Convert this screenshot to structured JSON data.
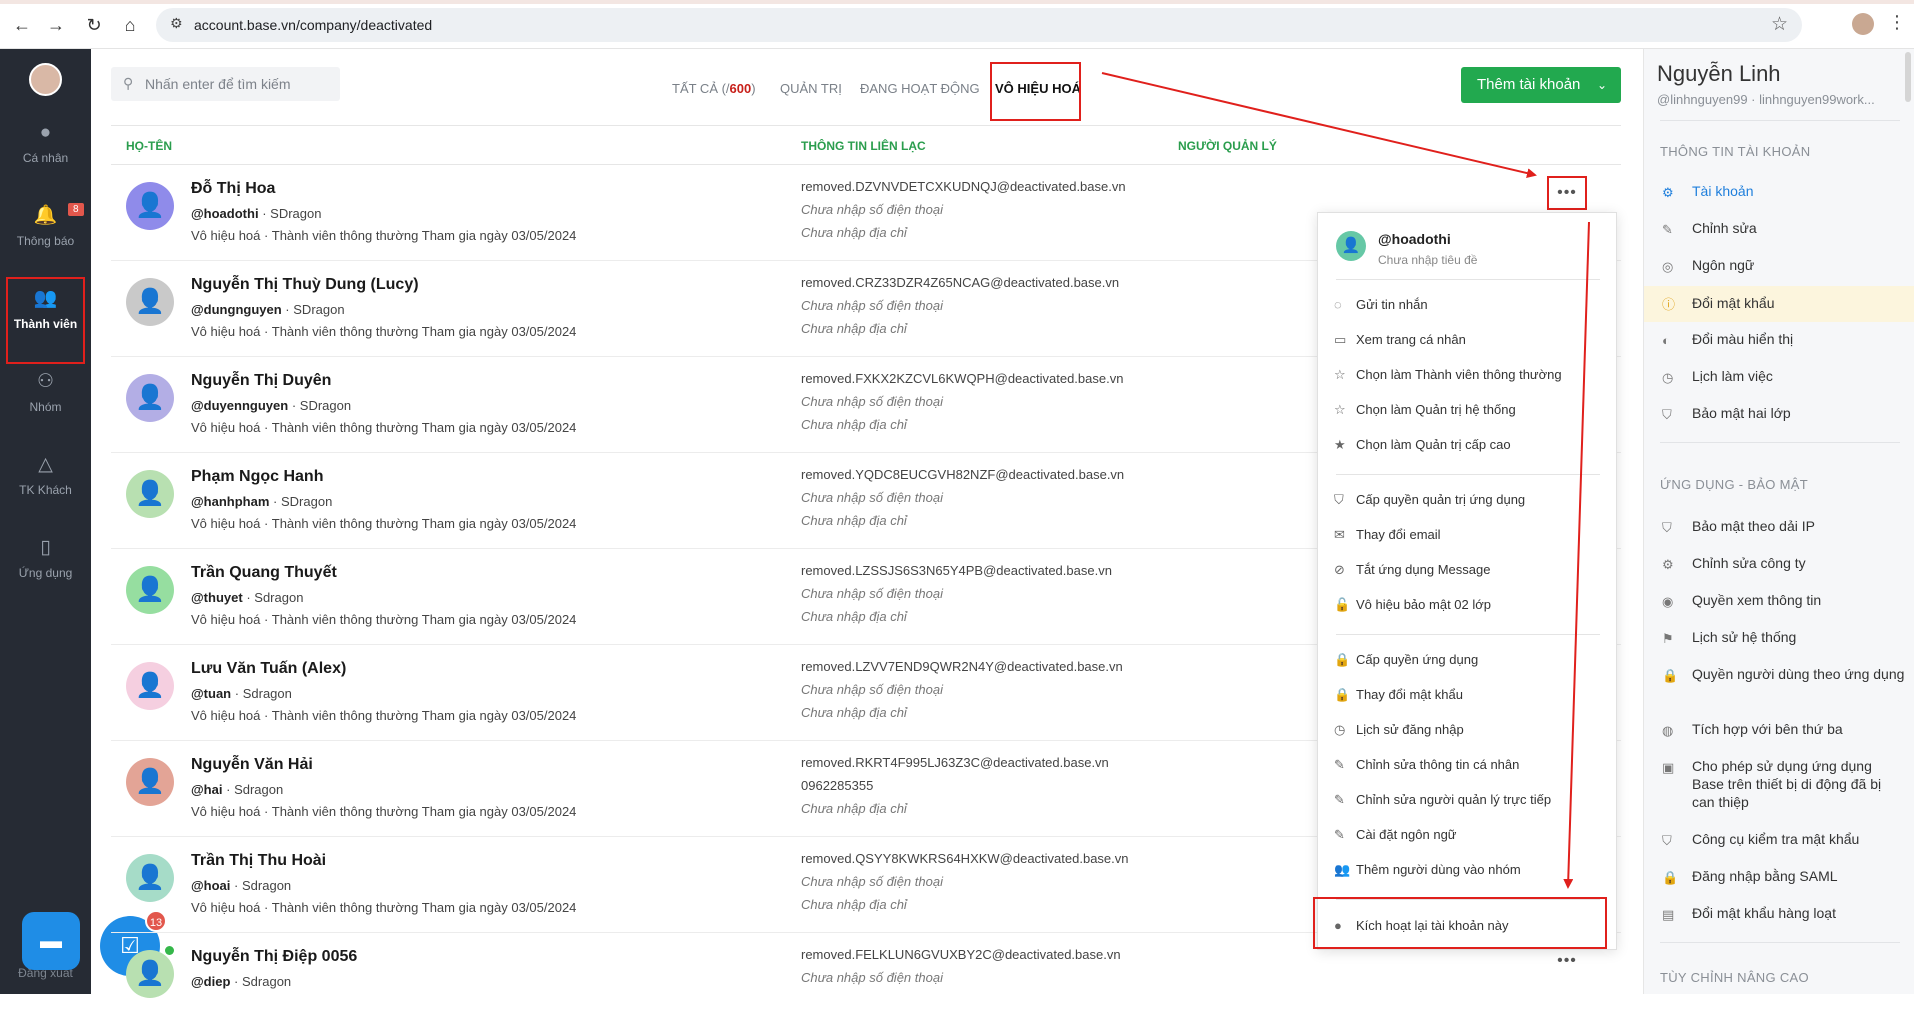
{
  "browser": {
    "url": "account.base.vn/company/deactivated",
    "back_icon": "←",
    "forward_icon": "→",
    "reload_icon": "↻",
    "home_icon": "⌂",
    "star_icon": "☆",
    "tune_icon": "⚙",
    "menu_icon": "⋮"
  },
  "sidebar": {
    "items": [
      {
        "label": "Cá nhân",
        "icon": "●"
      },
      {
        "label": "Thông báo",
        "icon": "🔔",
        "badge": "8"
      },
      {
        "label": "Thành viên",
        "icon": "👥"
      },
      {
        "label": "Nhóm",
        "icon": "⚇"
      },
      {
        "label": "TK Khách",
        "icon": "△"
      },
      {
        "label": "Ứng dụng",
        "icon": "▯"
      }
    ],
    "logout": "Đăng xuất",
    "chat_icon": "▬",
    "task_icon": "☑",
    "task_badge": "13"
  },
  "toolbar": {
    "search_placeholder": "Nhấn enter để tìm kiếm",
    "search_icon": "⚲",
    "tabs": {
      "all_prefix": "TẤT CẢ (/",
      "all_count": "600",
      "all_suffix": ")",
      "admin": "QUẢN TRỊ",
      "active": "ĐANG HOẠT ĐỘNG",
      "deactivated": "VÔ HIỆU HOÁ"
    },
    "add_button": "Thêm tài khoản",
    "add_chevron": "⌄"
  },
  "table": {
    "headers": {
      "name": "HỌ-TÊN",
      "contact": "THÔNG TIN LIÊN LẠC",
      "manager": "NGƯỜI QUẢN LÝ"
    },
    "rows": [
      {
        "name": "Đỗ Thị Hoa",
        "handle": "@hoadothi",
        "team": "SDragon",
        "status": "Vô hiệu hoá",
        "role": "Thành viên thông thường Tham gia ngày 03/05/2024",
        "email": "removed.DZVNVDETCXKUDNQJ@deactivated.base.vn",
        "phone": "Chưa nhập số điện thoại",
        "address": "Chưa nhập địa chỉ"
      },
      {
        "name": "Nguyễn Thị Thuỳ Dung (Lucy)",
        "handle": "@dungnguyen",
        "team": "SDragon",
        "status": "Vô hiệu hoá",
        "role": "Thành viên thông thường Tham gia ngày 03/05/2024",
        "email": "removed.CRZ33DZR4Z65NCAG@deactivated.base.vn",
        "phone": "Chưa nhập số điện thoại",
        "address": "Chưa nhập địa chỉ"
      },
      {
        "name": "Nguyễn Thị Duyên",
        "handle": "@duyennguyen",
        "team": "SDragon",
        "status": "Vô hiệu hoá",
        "role": "Thành viên thông thường Tham gia ngày 03/05/2024",
        "email": "removed.FXKX2KZCVL6KWQPH@deactivated.base.vn",
        "phone": "Chưa nhập số điện thoại",
        "address": "Chưa nhập địa chỉ"
      },
      {
        "name": "Phạm Ngọc Hanh",
        "handle": "@hanhpham",
        "team": "SDragon",
        "status": "Vô hiệu hoá",
        "role": "Thành viên thông thường Tham gia ngày 03/05/2024",
        "email": "removed.YQDC8EUCGVH82NZF@deactivated.base.vn",
        "phone": "Chưa nhập số điện thoại",
        "address": "Chưa nhập địa chỉ"
      },
      {
        "name": "Trần Quang Thuyết",
        "handle": "@thuyet",
        "team": "Sdragon",
        "status": "Vô hiệu hoá",
        "role": "Thành viên thông thường Tham gia ngày 03/05/2024",
        "email": "removed.LZSSJS6S3N65Y4PB@deactivated.base.vn",
        "phone": "Chưa nhập số điện thoại",
        "address": "Chưa nhập địa chỉ"
      },
      {
        "name": "Lưu Văn Tuấn (Alex)",
        "handle": "@tuan",
        "team": "Sdragon",
        "status": "Vô hiệu hoá",
        "role": "Thành viên thông thường Tham gia ngày 03/05/2024",
        "email": "removed.LZVV7END9QWR2N4Y@deactivated.base.vn",
        "phone": "Chưa nhập số điện thoại",
        "address": "Chưa nhập địa chỉ"
      },
      {
        "name": "Nguyễn Văn Hải",
        "handle": "@hai",
        "team": "Sdragon",
        "status": "Vô hiệu hoá",
        "role": "Thành viên thông thường Tham gia ngày 03/05/2024",
        "email": "removed.RKRT4F995LJ63Z3C@deactivated.base.vn",
        "phone": "0962285355",
        "address": "Chưa nhập địa chỉ"
      },
      {
        "name": "Trần Thị Thu Hoài",
        "handle": "@hoai",
        "team": "Sdragon",
        "status": "Vô hiệu hoá",
        "role": "Thành viên thông thường Tham gia ngày 03/05/2024",
        "email": "removed.QSYY8KWKRS64HXKW@deactivated.base.vn",
        "phone": "Chưa nhập số điện thoại",
        "address": "Chưa nhập địa chỉ"
      },
      {
        "name": "Nguyễn Thị Điệp 0056",
        "handle": "@diep",
        "team": "Sdragon",
        "status": "",
        "role": "",
        "email": "removed.FELKLUN6GVUXBY2C@deactivated.base.vn",
        "phone": "Chưa nhập số điện thoại",
        "address": ""
      }
    ],
    "more_icon": "•••",
    "avatar_icon": "👤",
    "dot": "·"
  },
  "context_menu": {
    "handle": "@hoadothi",
    "tagline": "Chưa nhập tiêu đề",
    "items": [
      {
        "icon": "◌",
        "label": "Gửi tin nhắn"
      },
      {
        "icon": "▭",
        "label": "Xem trang cá nhân"
      },
      {
        "icon": "☆",
        "label": "Chọn làm Thành viên thông thường"
      },
      {
        "icon": "☆",
        "label": "Chọn làm Quản trị hệ thống"
      },
      {
        "icon": "★",
        "label": "Chọn làm Quản trị cấp cao"
      },
      {
        "icon": "⛉",
        "label": "Cấp quyền quản trị ứng dụng"
      },
      {
        "icon": "✉",
        "label": "Thay đổi email"
      },
      {
        "icon": "⊘",
        "label": "Tắt ứng dụng Message"
      },
      {
        "icon": "🔓",
        "label": "Vô hiệu bảo mật 02 lớp"
      },
      {
        "icon": "🔒",
        "label": "Cấp quyền ứng dụng"
      },
      {
        "icon": "🔒",
        "label": "Thay đổi mật khẩu"
      },
      {
        "icon": "◷",
        "label": "Lịch sử đăng nhập"
      },
      {
        "icon": "✎",
        "label": "Chỉnh sửa thông tin cá nhân"
      },
      {
        "icon": "✎",
        "label": "Chỉnh sửa người quản lý trực tiếp"
      },
      {
        "icon": "✎",
        "label": "Cài đặt ngôn ngữ"
      },
      {
        "icon": "👥",
        "label": "Thêm người dùng vào nhóm"
      },
      {
        "icon": "●",
        "label": "Kích hoạt lại tài khoản này"
      }
    ]
  },
  "right_panel": {
    "name": "Nguyễn Linh",
    "handle": "@linhnguyen99 · linhnguyen99work...",
    "sections": {
      "account": "THÔNG TIN TÀI KHOẢN",
      "apps": "ỨNG DỤNG - BẢO MẬT",
      "advanced": "TÙY CHỈNH NÂNG CAO"
    },
    "account_items": [
      {
        "icon": "⚙",
        "label": "Tài khoản"
      },
      {
        "icon": "✎",
        "label": "Chỉnh sửa"
      },
      {
        "icon": "◎",
        "label": "Ngôn ngữ"
      },
      {
        "icon": "ⓘ",
        "label": "Đổi mật khẩu"
      },
      {
        "icon": "◐",
        "label": "Đổi màu hiển thị"
      },
      {
        "icon": "◷",
        "label": "Lịch làm việc"
      },
      {
        "icon": "⛉",
        "label": "Bảo mật hai lớp"
      }
    ],
    "app_items": [
      {
        "icon": "⛉",
        "label": "Bảo mật theo dải IP"
      },
      {
        "icon": "⚙",
        "label": "Chỉnh sửa công ty"
      },
      {
        "icon": "◉",
        "label": "Quyền xem thông tin"
      },
      {
        "icon": "⚑",
        "label": "Lịch sử hệ thống"
      },
      {
        "icon": "🔒",
        "label": "Quyền người dùng theo ứng dụng"
      },
      {
        "icon": "◍",
        "label": "Tích hợp với bên thứ ba"
      },
      {
        "icon": "▣",
        "label": "Cho phép sử dụng ứng dụng Base trên thiết bị di động đã bị can thiệp"
      },
      {
        "icon": "⛉",
        "label": "Công cụ kiểm tra mật khẩu"
      },
      {
        "icon": "🔒",
        "label": "Đăng nhập bằng SAML"
      },
      {
        "icon": "▤",
        "label": "Đổi mật khẩu hàng loạt"
      }
    ]
  },
  "colors": {
    "accent_green": "#22a94f",
    "header_green": "#2a9d4d",
    "annotation_red": "#e0201c",
    "link_blue": "#1f7fdc",
    "sidebar_bg": "#262b34"
  }
}
